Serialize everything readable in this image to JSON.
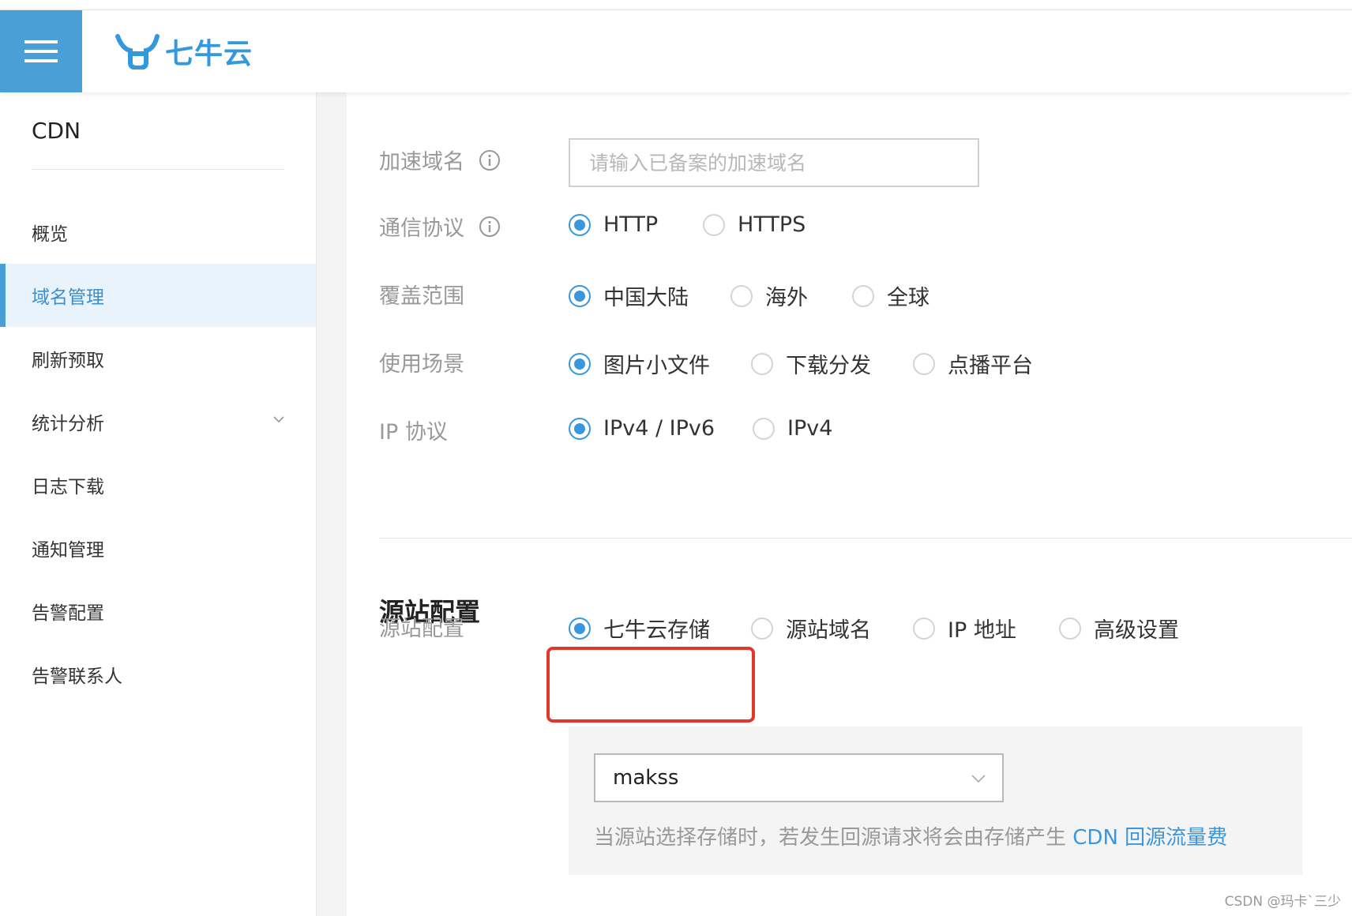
{
  "header": {
    "brand": "七牛云"
  },
  "sidebar": {
    "title": "CDN",
    "items": [
      {
        "label": "概览"
      },
      {
        "label": "域名管理",
        "active": true
      },
      {
        "label": "刷新预取"
      },
      {
        "label": "统计分析",
        "expandable": true
      },
      {
        "label": "日志下载"
      },
      {
        "label": "通知管理"
      },
      {
        "label": "告警配置"
      },
      {
        "label": "告警联系人"
      }
    ]
  },
  "form": {
    "domain": {
      "label": "加速域名",
      "placeholder": "请输入已备案的加速域名",
      "value": ""
    },
    "protocol": {
      "label": "通信协议",
      "options": [
        "HTTP",
        "HTTPS"
      ],
      "selected": "HTTP"
    },
    "coverage": {
      "label": "覆盖范围",
      "options": [
        "中国大陆",
        "海外",
        "全球"
      ],
      "selected": "中国大陆"
    },
    "scenario": {
      "label": "使用场景",
      "options": [
        "图片小文件",
        "下载分发",
        "点播平台"
      ],
      "selected": "图片小文件"
    },
    "ip_protocol": {
      "label": "IP 协议",
      "options": [
        "IPv4 / IPv6",
        "IPv4"
      ],
      "selected": "IPv4 / IPv6"
    }
  },
  "origin": {
    "section_title": "源站配置",
    "label": "源站配置",
    "options": [
      "七牛云存储",
      "源站域名",
      "IP 地址",
      "高级设置"
    ],
    "selected": "七牛云存储",
    "bucket": "makss",
    "hint_text": "当源站选择存储时，若发生回源请求将会由存储产生 ",
    "hint_link": "CDN 回源流量费"
  },
  "colors": {
    "accent": "#3a96dd",
    "highlight_border": "#e0382b",
    "header_menu_bg": "#4a9fd8"
  },
  "watermark": "CSDN @玛卡`三少"
}
